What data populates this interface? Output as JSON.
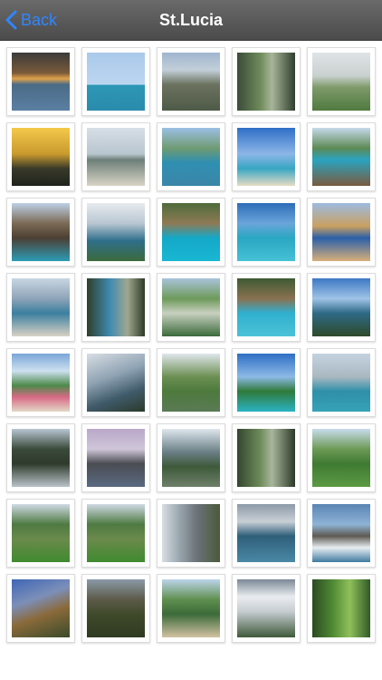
{
  "nav": {
    "back_label": "Back",
    "title": "St.Lucia",
    "accent": "#2f86ff"
  },
  "photos": [
    {
      "bg": "linear-gradient(#3b3b3b 0%, #7a5a3a 35%, #e0a24a 45%, #4a6b86 55%, #5b7fa2 100%)"
    },
    {
      "bg": "linear-gradient(#aac9ea 0%, #bcd6f0 55%, #2c97b6 56%, #2b8bad 100%)"
    },
    {
      "bg": "linear-gradient(#9fb5cf 0%, #c3cfd9 30%, #6b725f 55%, #4e5a47 100%)"
    },
    {
      "bg": "linear-gradient(90deg, #3b4b3a 0%, #6f8b5a 40%, #a8b59a 60%, #2f3f2c 100%)"
    },
    {
      "bg": "linear-gradient(#dfe4e6 0%, #c9d1cf 40%, #7e9a6a 60%, #4f7a3f 100%)"
    },
    {
      "bg": "linear-gradient(#f4c94a 0%, #c99a2e 45%, #3a3a2a 70%, #1e241c 100%)"
    },
    {
      "bg": "linear-gradient(#d7dee6 0%, #b8c6cf 45%, #6c7f78 55%, #d9d4c6 100%)"
    },
    {
      "bg": "linear-gradient(#9cc0e6 0%, #6f9b72 35%, #2f8fb2 60%, #3b86a8 100%)"
    },
    {
      "bg": "linear-gradient(#2f6fc7 0%, #8db6e6 45%, #38a6c4 70%, #e6dcc4 100%)"
    },
    {
      "bg": "linear-gradient(#c6d9ea 0%, #5d8a55 35%, #2aa3c0 55%, #7a5a3e 100%)"
    },
    {
      "bg": "linear-gradient(#bcd0e6 0%, #7b6a55 35%, #4c3f33 60%, #2d9bb6 100%)"
    },
    {
      "bg": "linear-gradient(#e7ebef 0%, #b8c6d2 35%, #2f6e8a 65%, #3b6b3b 100%)"
    },
    {
      "bg": "linear-gradient(#4e6b3b 0%, #8e7a55 35%, #14a8c8 60%, #19b7d2 100%)"
    },
    {
      "bg": "linear-gradient(#2e6db8 0%, #6aa5da 35%, #2aa7c2 60%, #46c1d6 100%)"
    },
    {
      "bg": "linear-gradient(#9dbbe1 0%, #c9a061 40%, #2b5fa8 60%, #d8b07a 100%)"
    },
    {
      "bg": "linear-gradient(#c8d6e2 0%, #8ea4b8 35%, #3b7fa0 60%, #d8d2c4 100%)"
    },
    {
      "bg": "linear-gradient(90deg, #2f3f2a 0%, #3f8bb2 40%, #a0a78f 70%, #2e3a26 100%)"
    },
    {
      "bg": "linear-gradient(#a9c3da 0%, #6d9a5a 35%, #c8d0c0 60%, #3b6b3b 100%)"
    },
    {
      "bg": "linear-gradient(#3d5a33 0%, #8a7150 35%, #2fb0d0 60%, #4cc2d6 100%)"
    },
    {
      "bg": "linear-gradient(#3d78c4 0%, #9fc3e6 35%, #2e6a86 60%, #2e4a2a 100%)"
    },
    {
      "bg": "linear-gradient(#7aa6d8 0%, #cde0ef 30%, #4d8a4a 55%, #d86a86 75%, #e2d8c6 100%)"
    },
    {
      "bg": "linear-gradient(160deg, #d8dde4 0%, #8fa3b3 40%, #3f5a6a 70%, #2b3a2a 100%)"
    },
    {
      "bg": "linear-gradient(#dfe6ea 0%, #6c8f53 40%, #4d7a3d 65%, #5a7a55 100%)"
    },
    {
      "bg": "linear-gradient(#2e6fc4 0%, #8db9e6 40%, #2f7a3a 65%, #2bb3c4 100%)"
    },
    {
      "bg": "linear-gradient(#c4d3df 0%, #aab8c2 40%, #2f8fa8 65%, #36a2b8 100%)"
    },
    {
      "bg": "linear-gradient(#b8c6d2 0%, #3a4a3a 35%, #2f3a2c 60%, #b9c3c9 100%)"
    },
    {
      "bg": "linear-gradient(#b9a7c9 0%, #cfc6d9 35%, #4a4c52 60%, #5a6a82 100%)"
    },
    {
      "bg": "linear-gradient(#dfe6ed 0%, #6a7f86 40%, #3d5a3a 65%, #6f7f6a 100%)"
    },
    {
      "bg": "linear-gradient(90deg, #34452f 0%, #6e8c5a 40%, #a9b69c 60%, #2b3a28 100%)"
    },
    {
      "bg": "linear-gradient(#c9dced 0%, #6c9a55 35%, #3f7a33 60%, #5d9a44 100%)"
    },
    {
      "bg": "linear-gradient(#cfdae4 0%, #4e7a42 35%, #6b8a4c 60%, #3f8a2f 100%)"
    },
    {
      "bg": "linear-gradient(#cfdae4 0%, #4e7a42 35%, #6b8a4c 60%, #3f8a2f 100%)"
    },
    {
      "bg": "linear-gradient(90deg, #d8dde2 0%, #9aa6ae 30%, #6b7278 60%, #4a5a3a 100%)"
    },
    {
      "bg": "linear-gradient(#8c9aa8 0%, #c9cfd6 30%, #2f5f7a 55%, #4a88a6 100%)"
    },
    {
      "bg": "linear-gradient(#5a84b4 0%, #8fb3d6 35%, #5e5a52 55%, #e8eef2 75%, #3f7aa0 100%)"
    },
    {
      "bg": "linear-gradient(160deg, #3e66b6 0%, #7c8fb8 35%, #8a6a3a 60%, #3b4a2a 100%)"
    },
    {
      "bg": "linear-gradient(#8a9aa8 0%, #5c5a48 35%, #3f4a2a 60%, #2f3a22 100%)"
    },
    {
      "bg": "linear-gradient(#bcd4ea 0%, #5f8f4f 35%, #3c6a3a 60%, #d2c2a2 100%)"
    },
    {
      "bg": "linear-gradient(#7b8896 0%, #e9edf0 30%, #c7cdd2 55%, #3f5a3a 100%)"
    },
    {
      "bg": "linear-gradient(90deg, #2c4a22 0%, #4f8a33 35%, #8fbf5a 65%, #2f5a26 100%)"
    }
  ]
}
